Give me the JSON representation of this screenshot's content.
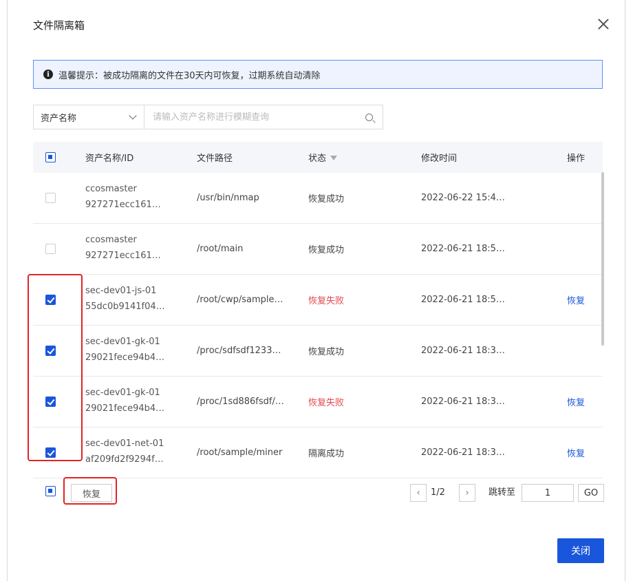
{
  "dialog": {
    "title": "文件隔离箱",
    "notice": "温馨提示：被成功隔离的文件在30天内可恢复，过期系统自动清除"
  },
  "search": {
    "field_label": "资产名称",
    "placeholder": "请输入资产名称进行模糊查询"
  },
  "table": {
    "columns": {
      "asset": "资产名称/ID",
      "path": "文件路径",
      "status": "状态",
      "modified": "修改时间",
      "action": "操作"
    },
    "rows": [
      {
        "name": "ccosmaster",
        "id": "927271ecc161…",
        "path": "/usr/bin/nmap",
        "status": "恢复成功",
        "time": "2022-06-22 15:4…",
        "action": "",
        "checked": false
      },
      {
        "name": "ccosmaster",
        "id": "927271ecc161…",
        "path": "/root/main",
        "status": "恢复成功",
        "time": "2022-06-21 18:5…",
        "action": "",
        "checked": false
      },
      {
        "name": "sec-dev01-js-01",
        "id": "55dc0b9141f04…",
        "path": "/root/cwp/sample…",
        "status": "恢复失败",
        "time": "2022-06-21 18:5…",
        "action": "恢复",
        "checked": true
      },
      {
        "name": "sec-dev01-gk-01",
        "id": "29021fece94b4…",
        "path": "/proc/sdfsdf1233…",
        "status": "恢复成功",
        "time": "2022-06-21 18:3…",
        "action": "",
        "checked": true
      },
      {
        "name": "sec-dev01-gk-01",
        "id": "29021fece94b4…",
        "path": "/proc/1sd886fsdf/…",
        "status": "恢复失败",
        "time": "2022-06-21 18:3…",
        "action": "恢复",
        "checked": true
      },
      {
        "name": "sec-dev01-net-01",
        "id": "af209fd2f9294f…",
        "path": "/root/sample/miner",
        "status": "隔离成功",
        "time": "2022-06-21 18:3…",
        "action": "恢复",
        "checked": true
      }
    ]
  },
  "footer": {
    "restore_label": "恢复",
    "page_indicator": "1/2",
    "jump_label": "跳转至",
    "jump_value": "1",
    "go_label": "GO",
    "close_label": "关闭"
  },
  "colors": {
    "primary": "#1a56db",
    "failed": "#e5484d",
    "highlight": "#e02424"
  }
}
